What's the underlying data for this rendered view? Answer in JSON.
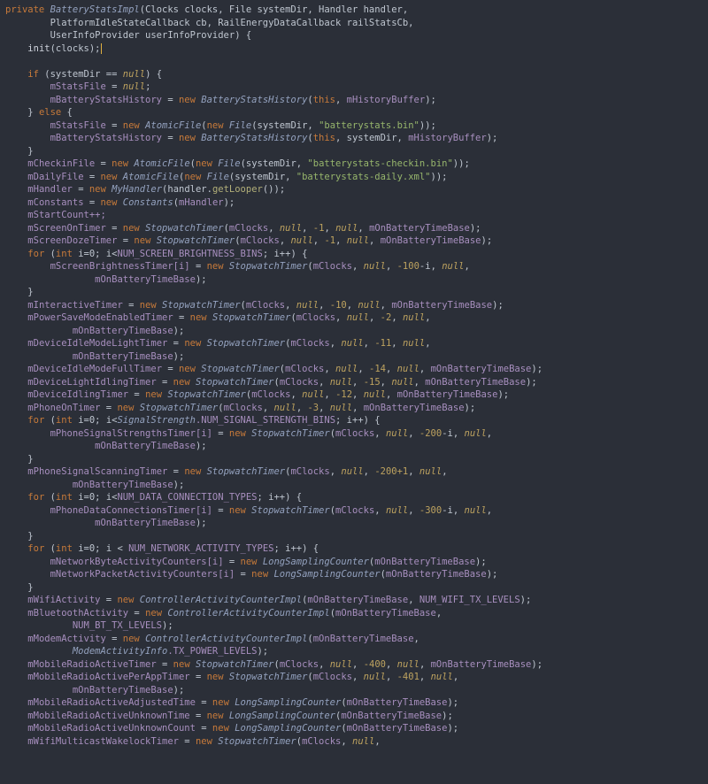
{
  "code": {
    "sig1_private": "private",
    "sig1_type": "BatteryStatsImpl",
    "sig1_rest": "(Clocks clocks, File systemDir, Handler handler,",
    "sig2": "PlatformIdleStateCallback cb, RailEnergyDataCallback railStatsCb,",
    "sig3": "UserInfoProvider userInfoProvider) {",
    "init": "init",
    "init_arg": "(clocks);",
    "if_kw": "if",
    "if_cond": " (systemDir == ",
    "if_cond2": ") {",
    "mStatsFile": "mStatsFile",
    "eq_null": " = ",
    "semi": ";",
    "mBatteryStatsHistory": "mBatteryStatsHistory",
    "eq_new": " = ",
    "new": "new",
    "BatteryStatsHistory": "BatteryStatsHistory",
    "this": "this",
    "mHistoryBuffer": "mHistoryBuffer",
    "else": "else",
    "AtomicFile": "AtomicFile",
    "File": "File",
    "str_bstats": "\"batterystats.bin\"",
    "str_checkin": "\"batterystats-checkin.bin\"",
    "str_daily": "\"batterystats-daily.xml\"",
    "mCheckinFile": "mCheckinFile",
    "mDailyFile": "mDailyFile",
    "mHandler": "mHandler",
    "MyHandler": "MyHandler",
    "getLooper": "getLooper",
    "mConstants": "mConstants",
    "Constants": "Constants",
    "mStartCount": "mStartCount++;",
    "mScreenOnTimer": "mScreenOnTimer",
    "mScreenDozeTimer": "mScreenDozeTimer",
    "StopwatchTimer": "StopwatchTimer",
    "mClocks": "mClocks",
    "neg1": "-1",
    "mOnBatteryTimeBase": "mOnBatteryTimeBase",
    "for": "for",
    "int": "int",
    "ieq0": " i=0; i<",
    "ieq0sp": " i=0; i < ",
    "NUM_SCREEN_BRIGHTNESS_BINS": "NUM_SCREEN_BRIGHTNESS_BINS",
    "ipp": "; i++) {",
    "mScreenBrightnessTimer": "mScreenBrightnessTimer[i]",
    "neg100": "-100",
    "minus_i": "-i",
    "mInteractiveTimer": "mInteractiveTimer",
    "neg10": "-10",
    "mPowerSave": "mPowerSaveModeEnabledTimer",
    "neg2": "-2",
    "mDeviceIdleLight": "mDeviceIdleModeLightTimer",
    "neg11": "-11",
    "mDeviceIdleFull": "mDeviceIdleModeFullTimer",
    "neg14": "-14",
    "mDeviceLightIdling": "mDeviceLightIdlingTimer",
    "neg15": "-15",
    "mDeviceIdlingTimer": "mDeviceIdlingTimer",
    "neg12": "-12",
    "mPhoneOnTimer": "mPhoneOnTimer",
    "neg3": "-3",
    "SignalStrength": "SignalStrength",
    "NUM_SIGNAL": ".NUM_SIGNAL_STRENGTH_BINS",
    "mPhoneSignalStrengths": "mPhoneSignalStrengthsTimer[i]",
    "neg200": "-200",
    "mPhoneSignalScanning": "mPhoneSignalScanningTimer",
    "neg200p1": "-200+1",
    "NUM_DATA_CONN": "NUM_DATA_CONNECTION_TYPES",
    "mPhoneDataConn": "mPhoneDataConnectionsTimer[i]",
    "neg300": "-300",
    "NUM_NET_ACT": "NUM_NETWORK_ACTIVITY_TYPES",
    "mNetByte": "mNetworkByteActivityCounters[i]",
    "mNetPacket": "mNetworkPacketActivityCounters[i]",
    "LongSamplingCounter": "LongSamplingCounter",
    "mWifiActivity": "mWifiActivity",
    "ControllerActivityCounterImpl": "ControllerActivityCounterImpl",
    "NUM_WIFI_TX": "NUM_WIFI_TX_LEVELS",
    "mBluetoothActivity": "mBluetoothActivity",
    "NUM_BT_TX": "NUM_BT_TX_LEVELS",
    "mModemActivity": "mModemActivity",
    "ModemActivityInfo": "ModemActivityInfo",
    "TX_POWER": ".TX_POWER_LEVELS",
    "mMobileRadioActiveTimer": "mMobileRadioActiveTimer",
    "neg400": "-400",
    "mMobileRadioActivePerApp": "mMobileRadioActivePerAppTimer",
    "neg401": "-401",
    "mMobileRadioAdjusted": "mMobileRadioActiveAdjustedTime",
    "mMobileRadioUnknownTime": "mMobileRadioActiveUnknownTime",
    "mMobileRadioUnknownCount": "mMobileRadioActiveUnknownCount",
    "mWifiMulticast": "mWifiMulticastWakelockTimer",
    "null": "null"
  }
}
